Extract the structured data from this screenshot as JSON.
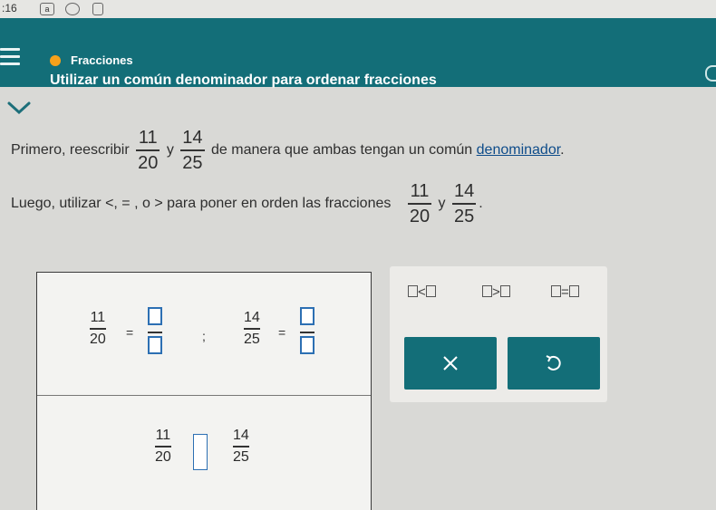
{
  "status_bar": {
    "time": ":16",
    "icon_a": "a"
  },
  "header": {
    "breadcrumb": "Fracciones",
    "title": "Utilizar un común denominador para ordenar fracciones",
    "accent": "#136e78",
    "dot_color": "#f6a11b"
  },
  "problem": {
    "line1_before": "Primero, reescribir",
    "line1_and": "y",
    "line1_after": "de manera que ambas tengan un común",
    "line1_link": "denominador",
    "line1_end": ".",
    "line2_before": "Luego, utilizar <, = , o > para poner en orden las fracciones",
    "line2_and": "y",
    "line2_end": ".",
    "frac1": {
      "num": "11",
      "den": "20"
    },
    "frac2": {
      "num": "14",
      "den": "25"
    }
  },
  "work": {
    "frac1": {
      "num": "11",
      "den": "20"
    },
    "frac2": {
      "num": "14",
      "den": "25"
    },
    "equals": "=",
    "separator": ";"
  },
  "palette": {
    "less_than": "<",
    "greater_than": ">",
    "equal": "=",
    "clear_icon": "x-icon",
    "undo_icon": "undo-icon"
  }
}
